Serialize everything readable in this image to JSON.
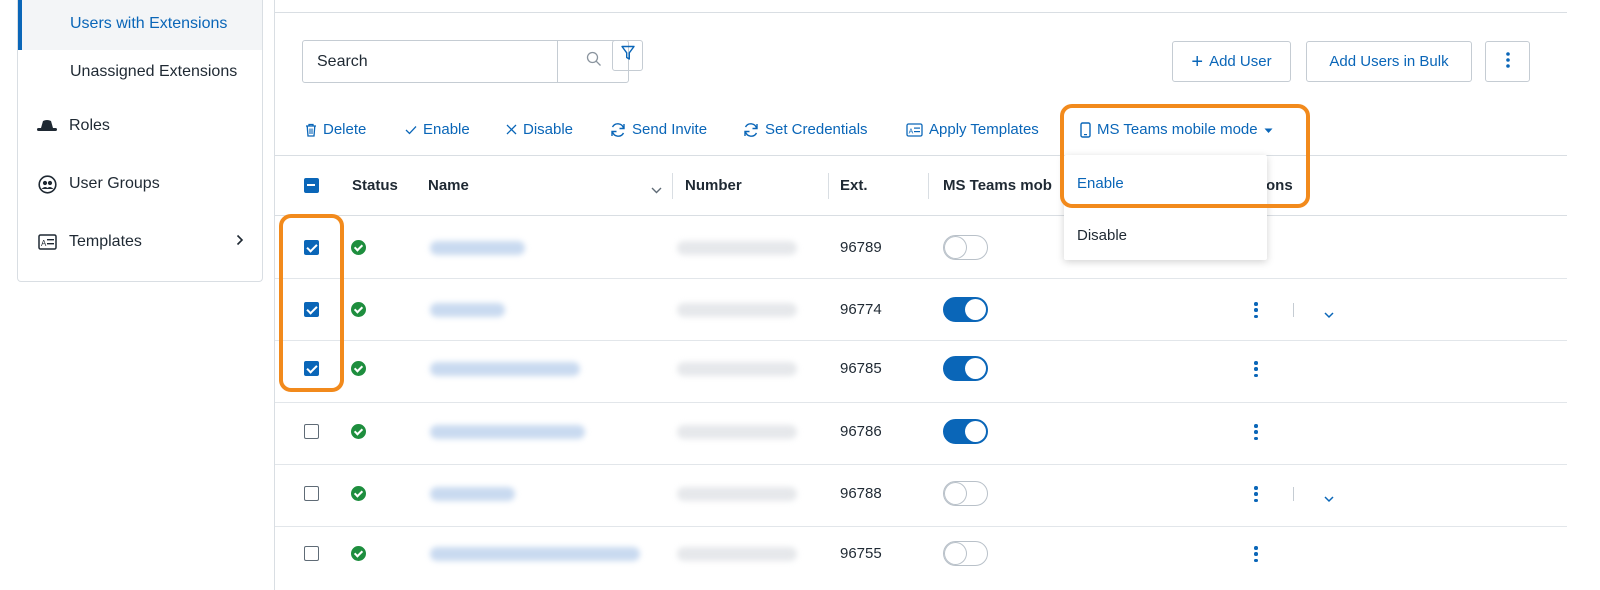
{
  "sidebar": {
    "items": [
      {
        "label": "Users with Extensions"
      },
      {
        "label": "Unassigned Extensions"
      },
      {
        "label": "Roles"
      },
      {
        "label": "User Groups"
      },
      {
        "label": "Templates"
      }
    ]
  },
  "toolbar": {
    "search_placeholder": "Search",
    "add_user_label": "Add User",
    "add_bulk_label": "Add Users in Bulk"
  },
  "actions": {
    "delete": "Delete",
    "enable": "Enable",
    "disable": "Disable",
    "send_invite": "Send Invite",
    "set_credentials": "Set Credentials",
    "apply_templates": "Apply Templates",
    "ms_teams_mode": "MS Teams mobile mode"
  },
  "table": {
    "headers": {
      "status": "Status",
      "name": "Name",
      "number": "Number",
      "ext": "Ext.",
      "ms_teams": "MS Teams mob",
      "actions": "ons"
    },
    "rows": [
      {
        "ext": "96789",
        "checked": true,
        "toggle_on": false
      },
      {
        "ext": "96774",
        "checked": true,
        "toggle_on": true
      },
      {
        "ext": "96785",
        "checked": true,
        "toggle_on": true
      },
      {
        "ext": "96786",
        "checked": false,
        "toggle_on": true
      },
      {
        "ext": "96788",
        "checked": false,
        "toggle_on": false
      },
      {
        "ext": "96755",
        "checked": false,
        "toggle_on": false
      }
    ]
  },
  "dropdown": {
    "enable": "Enable",
    "disable": "Disable"
  },
  "colors": {
    "accent": "#0a66b8",
    "highlight": "#f28a1c",
    "status_ok": "#1e8e3e"
  }
}
